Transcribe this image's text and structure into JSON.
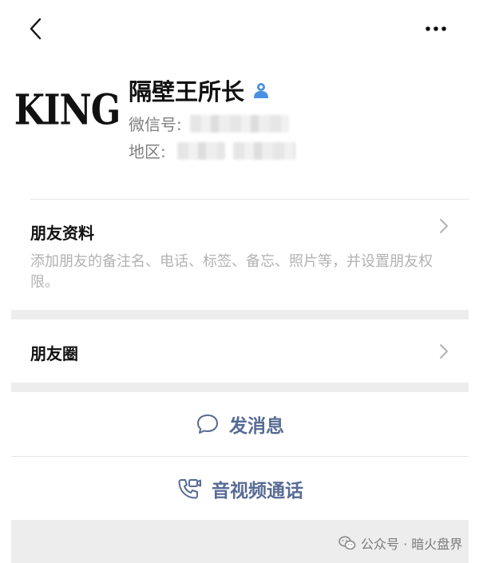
{
  "contact": {
    "avatar_text": "KING",
    "name": "隔壁王所长",
    "wechat_id_label": "微信号:",
    "region_label": "地区:"
  },
  "friend_profile": {
    "title": "朋友资料",
    "description": "添加朋友的备注名、电话、标签、备忘、照片等，并设置朋友权限。"
  },
  "moments": {
    "title": "朋友圈"
  },
  "actions": {
    "message": "发消息",
    "call": "音视频通话"
  },
  "watermark": "公众号 · 暗火盘界",
  "colors": {
    "link_blue": "#576b95",
    "verified_blue": "#4a90e2",
    "gray_text": "#7f7f7f",
    "light_text": "#b2b2b2",
    "section_gap": "#ededed"
  },
  "icons": {
    "back": "back-arrow-icon",
    "more": "more-dots-icon",
    "verified": "verified-user-icon",
    "chevron": "chevron-right-icon",
    "message": "chat-bubble-icon",
    "call": "video-call-icon",
    "wechat": "wechat-logo-icon"
  }
}
